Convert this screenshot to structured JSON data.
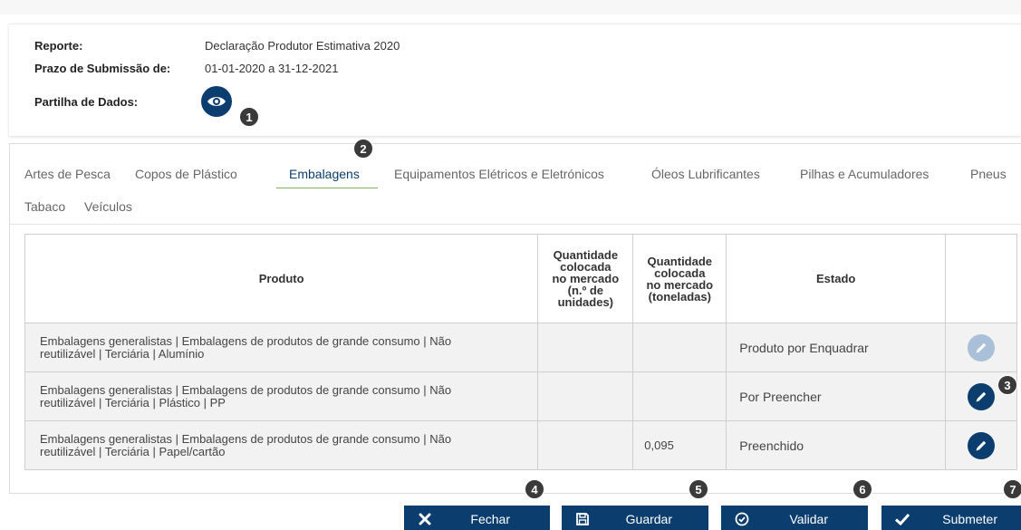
{
  "colors": {
    "primary": "#0b3d6e",
    "disabled": "#a9c0d8",
    "tab_active_underline": "#7ab55c",
    "row_bg": "#f2f2f2"
  },
  "info": {
    "reporte_label": "Reporte:",
    "reporte_value": "Declaração Produtor Estimativa 2020",
    "prazo_label": "Prazo de Submissão de:",
    "prazo_value": "01-01-2020 a 31-12-2021",
    "partilha_label": "Partilha de Dados:",
    "partilha_icon": "eye-icon"
  },
  "tabs": [
    {
      "label": "Artes de Pesca"
    },
    {
      "label": "Copos de Plástico"
    },
    {
      "label": "Embalagens",
      "active": true
    },
    {
      "label": "Equipamentos Elétricos e Eletrónicos"
    },
    {
      "label": "Óleos Lubrificantes"
    },
    {
      "label": "Pilhas e Acumuladores"
    },
    {
      "label": "Pneus"
    },
    {
      "label": "Tabaco"
    },
    {
      "label": "Veículos"
    }
  ],
  "table": {
    "headers": {
      "produto": "Produto",
      "qtd_unidades": [
        "Quantidade",
        "colocada",
        "no mercado",
        "(n.º de",
        "unidades)"
      ],
      "qtd_toneladas": [
        "Quantidade",
        "colocada",
        "no mercado",
        "(toneladas)"
      ],
      "estado": "Estado"
    },
    "rows": [
      {
        "produto_line1": "Embalagens generalistas | Embalagens de produtos de grande consumo | Não",
        "produto_line2": "reutilizável | Terciária | Alumínio",
        "unidades": "",
        "toneladas": "",
        "estado": "Produto por Enquadrar",
        "action_icon": "pencil-icon",
        "action_enabled": false
      },
      {
        "produto_line1": "Embalagens generalistas | Embalagens de produtos de grande consumo | Não",
        "produto_line2": "reutilizável | Terciária | Plástico | PP",
        "unidades": "",
        "toneladas": "",
        "estado": "Por Preencher",
        "action_icon": "pencil-icon",
        "action_enabled": true
      },
      {
        "produto_line1": "Embalagens generalistas | Embalagens de produtos de grande consumo | Não",
        "produto_line2": "reutilizável | Terciária | Papel/cartão",
        "unidades": "",
        "toneladas": "0,095",
        "estado": "Preenchido",
        "action_icon": "pencil-icon",
        "action_enabled": true
      }
    ]
  },
  "buttons": {
    "fechar": {
      "label": "Fechar",
      "icon": "close-x-icon"
    },
    "guardar": {
      "label": "Guardar",
      "icon": "save-floppy-icon"
    },
    "validar": {
      "label": "Validar",
      "icon": "check-circle-icon"
    },
    "submeter": {
      "label": "Submeter",
      "icon": "checkmark-icon"
    }
  },
  "badges": [
    "1",
    "2",
    "3",
    "4",
    "5",
    "6",
    "7"
  ]
}
